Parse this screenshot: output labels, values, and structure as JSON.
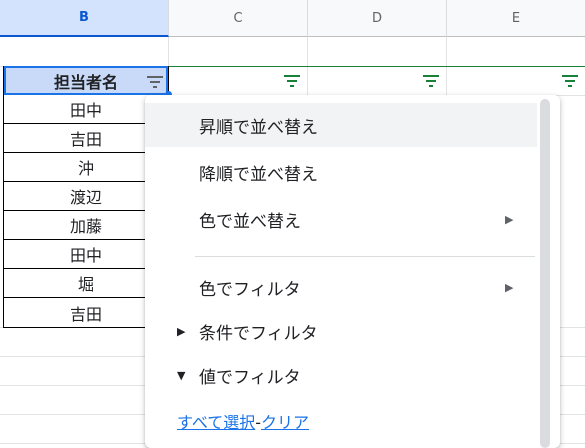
{
  "columns": [
    "B",
    "C",
    "D",
    "E"
  ],
  "header_cell": "担当者名",
  "names": [
    "田中",
    "吉田",
    "沖",
    "渡辺",
    "加藤",
    "田中",
    "堀",
    "吉田"
  ],
  "menu": {
    "items": [
      "昇順で並べ替え",
      "降順で並べ替え",
      "色で並べ替え",
      "色でフィルタ",
      "条件でフィルタ",
      "値でフィルタ"
    ],
    "select_all": "すべて選択",
    "separator": "-",
    "clear": "クリア"
  },
  "colors": {
    "accent": "#0b57d0",
    "filter_icon": "#188038",
    "link": "#1a73e8"
  }
}
